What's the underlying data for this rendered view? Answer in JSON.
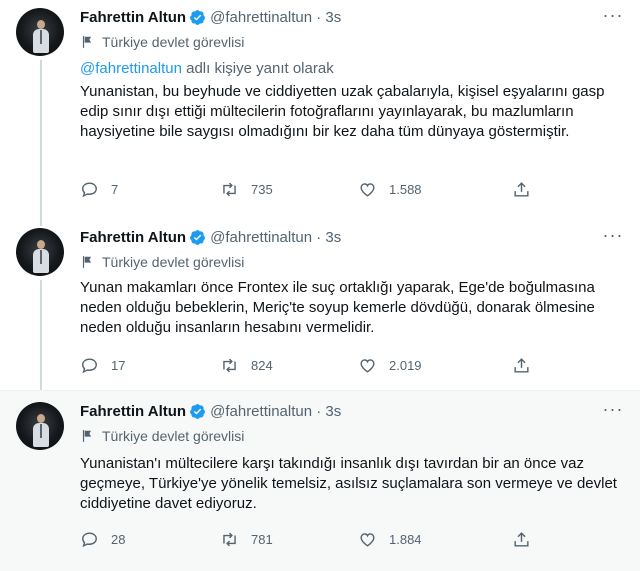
{
  "tweets": [
    {
      "name": "Fahrettin Altun",
      "handle": "@fahrettinaltun · 3s",
      "label": "Türkiye devlet görevlisi",
      "reply_mention": "@fahrettinaltun",
      "reply_suffix": " adlı kişiye yanıt olarak",
      "text": "Yunanistan, bu beyhude ve ciddiyetten uzak çabalarıyla, kişisel eşyalarını gasp edip sınır dışı ettiği mültecilerin fotoğraflarını yayınlayarak, bu mazlumların haysiyetine bile saygısı olmadığını bir kez daha tüm dünyaya göstermiştir.",
      "replies": "7",
      "retweets": "735",
      "likes": "1.588"
    },
    {
      "name": "Fahrettin Altun",
      "handle": "@fahrettinaltun · 3s",
      "label": "Türkiye devlet görevlisi",
      "text": "Yunan makamları önce Frontex ile suç ortaklığı yaparak, Ege'de boğulmasına neden olduğu bebeklerin, Meriç'te soyup kemerle dövdüğü, donarak ölmesine neden olduğu insanların hesabını vermelidir.",
      "replies": "17",
      "retweets": "824",
      "likes": "2.019"
    },
    {
      "name": "Fahrettin Altun",
      "handle": "@fahrettinaltun · 3s",
      "label": "Türkiye devlet görevlisi",
      "text": "Yunanistan'ı mültecilere karşı takındığı insanlık dışı tavırdan bir an önce vaz geçmeye, Türkiye'ye yönelik temelsiz, asılsız suçlamalara son vermeye ve devlet ciddiyetine davet ediyoruz.",
      "replies": "28",
      "retweets": "781",
      "likes": "1.884"
    }
  ],
  "colors": {
    "verified": "#1d9bf0",
    "secondary_text": "#536471",
    "link": "#1d9bf0",
    "thread_line": "#cfd9de",
    "highlight_bg": "#f7f9f9"
  },
  "icons": {
    "verified": "verified-badge-icon",
    "label": "flag-icon",
    "more": "more-dots-icon",
    "reply": "reply-bubble-icon",
    "retweet": "retweet-arrows-icon",
    "like": "heart-icon",
    "share": "share-upload-icon"
  }
}
